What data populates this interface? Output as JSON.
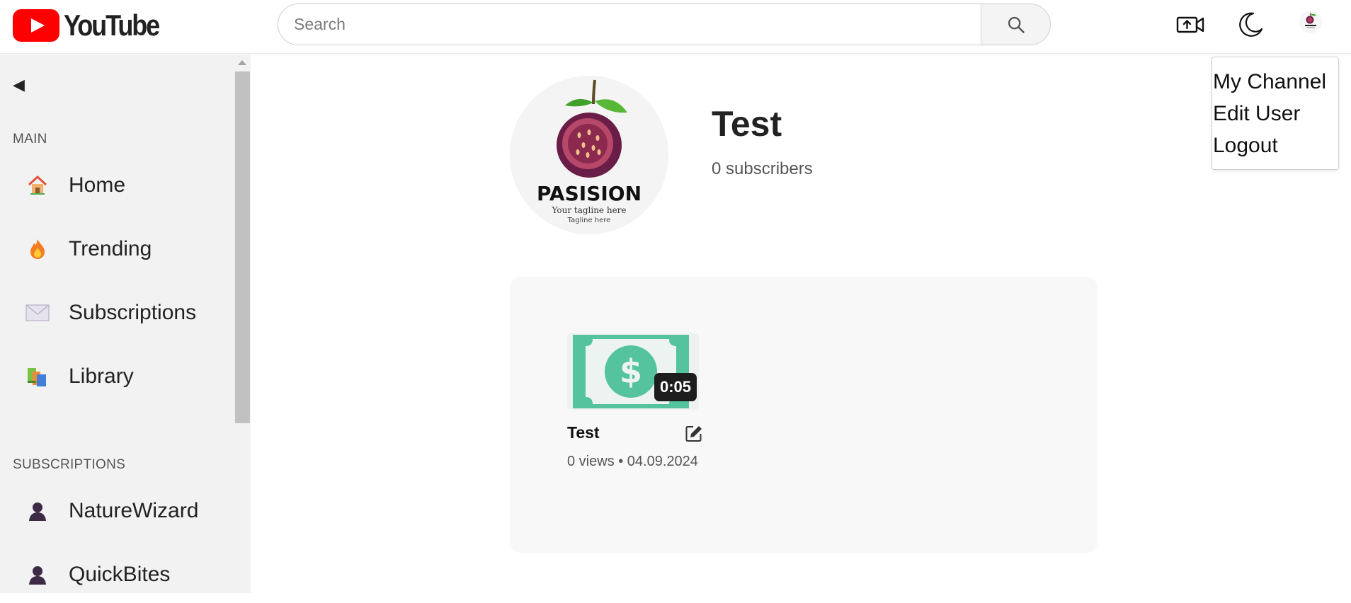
{
  "header": {
    "logo_text": "YouTube",
    "search_placeholder": "Search",
    "icons": [
      "upload-video-icon",
      "dark-mode-icon"
    ]
  },
  "dropdown": {
    "items": [
      "My Channel",
      "Edit User",
      "Logout"
    ]
  },
  "sidebar": {
    "collapse_label": "◀",
    "main_title": "MAIN",
    "main_items": [
      {
        "label": "Home",
        "icon": "home-icon"
      },
      {
        "label": "Trending",
        "icon": "fire-icon"
      },
      {
        "label": "Subscriptions",
        "icon": "envelope-icon"
      },
      {
        "label": "Library",
        "icon": "books-icon"
      }
    ],
    "subs_title": "SUBSCRIPTIONS",
    "subs_items": [
      {
        "label": "NatureWizard",
        "icon": "user-icon"
      },
      {
        "label": "QuickBites",
        "icon": "user-icon"
      }
    ]
  },
  "channel": {
    "name": "Test",
    "subscribers": "0 subscribers",
    "logo_text": "PASISION",
    "logo_tagline1": "Your tagline here",
    "logo_tagline2": "Tagline here"
  },
  "videos": [
    {
      "title": "Test",
      "duration": "0:05",
      "meta": "0 views • 04.09.2024",
      "thumb_icon": "dollar-bill-icon"
    }
  ],
  "colors": {
    "brand": "#ff0000",
    "sidebar_bg": "#f2f2f2",
    "panel_bg": "#f8f8f8",
    "bill_green": "#55c39e"
  }
}
